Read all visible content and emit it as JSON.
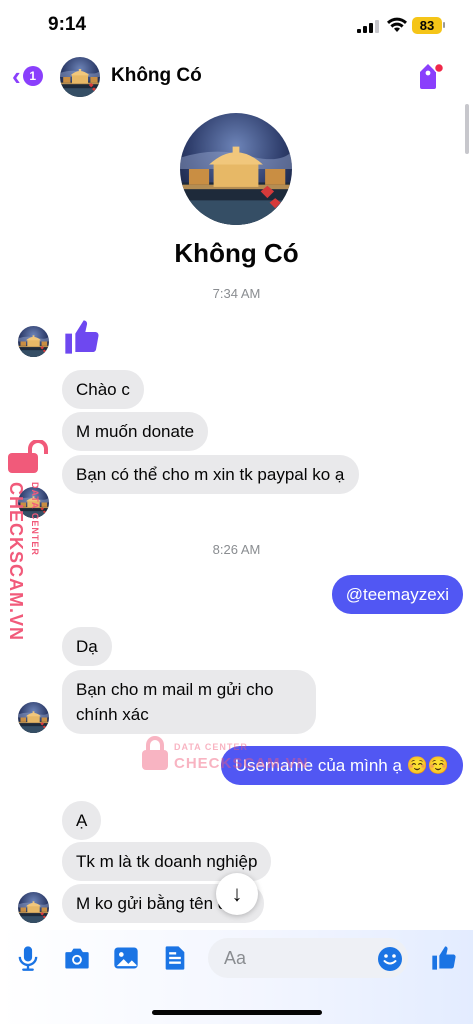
{
  "status_bar": {
    "time": "9:14",
    "battery": "83"
  },
  "header": {
    "back_badge": "1",
    "contact_name": "Không Có"
  },
  "profile": {
    "name": "Không Có"
  },
  "timestamps": [
    "7:34 AM",
    "8:26 AM"
  ],
  "messages": [
    {
      "from": "them",
      "text": "Chào c"
    },
    {
      "from": "them",
      "text": "M muốn donate"
    },
    {
      "from": "them",
      "text": "Bạn có thể cho m xin tk paypal ko ạ"
    },
    {
      "from": "me",
      "text": "@teemayzexi"
    },
    {
      "from": "them",
      "text": "Dạ"
    },
    {
      "from": "them",
      "text": "Bạn cho m mail m gửi cho chính xác"
    },
    {
      "from": "me",
      "text": "Username của mình ạ ☺️☺️"
    },
    {
      "from": "them",
      "text": "Ạ"
    },
    {
      "from": "them",
      "text": "Tk m là tk doanh nghiệp"
    },
    {
      "from": "them",
      "text": "M ko gửi bằng tên đc ạ"
    }
  ],
  "watermark": {
    "brand": "CHECKSCAM.VN",
    "tagline": "DATA CENTER",
    "brand2": "CHECKSCAM.VN",
    "tagline2": "DATA CENTER"
  },
  "composer": {
    "placeholder": "Aa"
  },
  "icons": {
    "back": "chevron-left-icon",
    "tag": "tag-icon",
    "like": "thumbs-up-icon",
    "mic": "microphone-icon",
    "camera": "camera-icon",
    "gallery": "image-icon",
    "file": "document-icon",
    "emoji": "smiley-icon",
    "scroll": "arrow-down-icon",
    "watermark": "lock-icon"
  },
  "colors": {
    "accent": "#8a3ffc",
    "outgoing_bubble": "#5157f3",
    "incoming_bubble": "#e9e9eb",
    "icon_blue": "#1b74e4",
    "watermark": "#f15a7a"
  }
}
